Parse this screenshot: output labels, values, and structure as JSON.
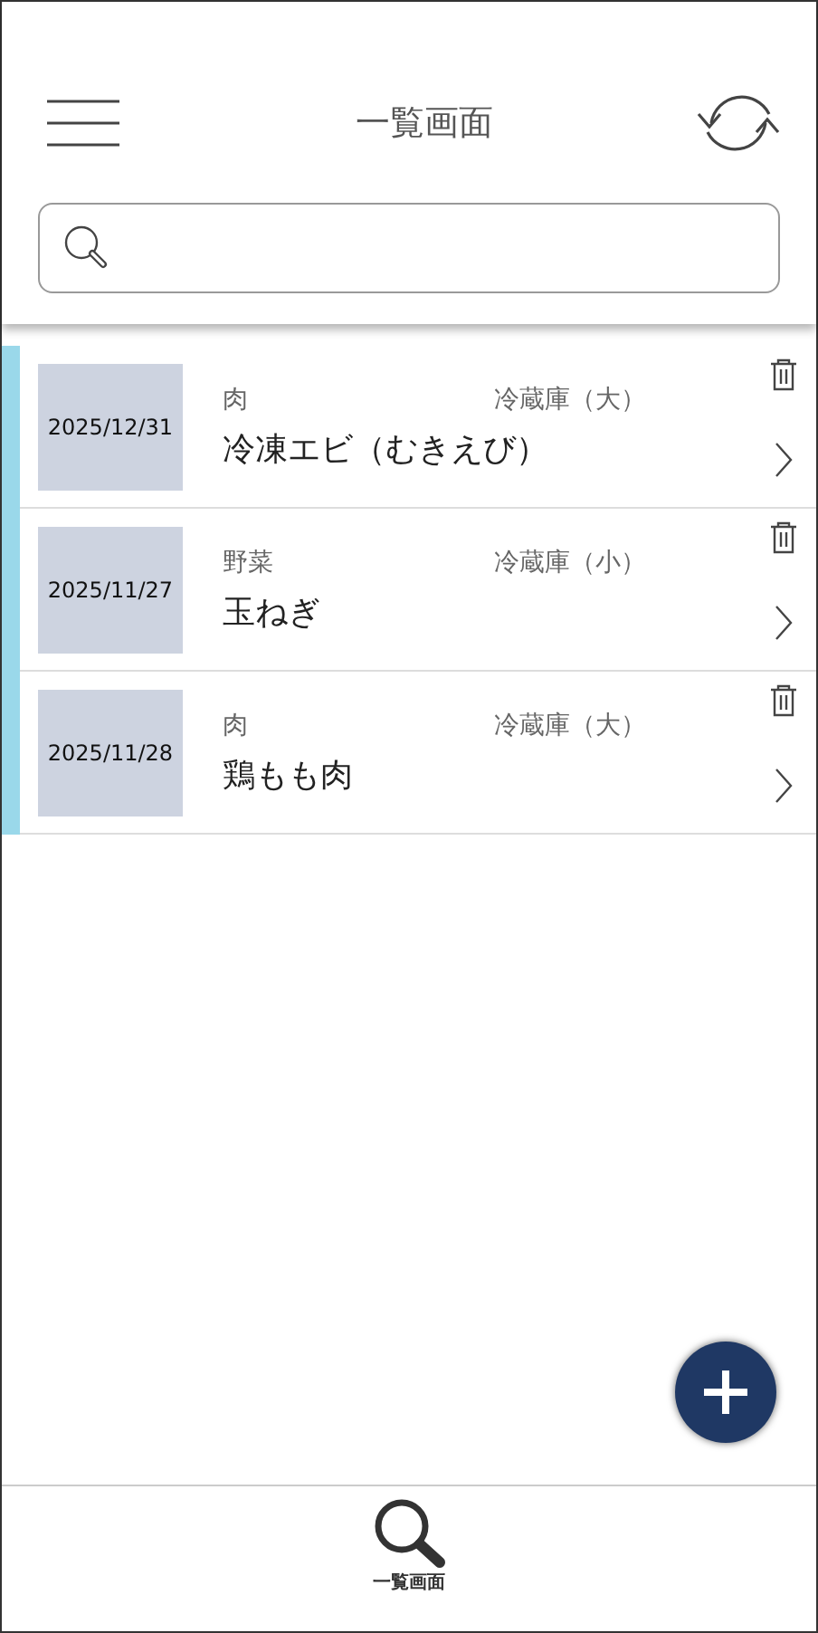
{
  "header": {
    "title": "一覧画面"
  },
  "items": [
    {
      "date": "2025/12/31",
      "category": "肉",
      "location": "冷蔵庫（大）",
      "name": "冷凍エビ（むきえび）"
    },
    {
      "date": "2025/11/27",
      "category": "野菜",
      "location": "冷蔵庫（小）",
      "name": "玉ねぎ"
    },
    {
      "date": "2025/11/28",
      "category": "肉",
      "location": "冷蔵庫（大）",
      "name": "鶏もも肉"
    }
  ],
  "bottom_nav": [
    {
      "label": "一覧画面",
      "selected": true
    }
  ]
}
